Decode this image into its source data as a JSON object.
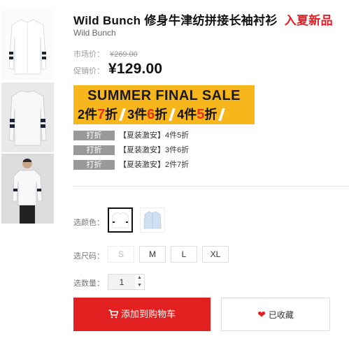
{
  "product": {
    "name": "Wild Bunch 修身牛津纺拼接长袖衬衫",
    "tag": "入夏新品",
    "brand": "Wild Bunch"
  },
  "price": {
    "market_label": "市场价：",
    "market_value": "¥269.00",
    "promo_label": "促销价：",
    "promo_value": "¥129.00"
  },
  "banner": {
    "line1": "SUMMER FINAL SALE",
    "offers": [
      {
        "pre": "2件",
        "num": "7",
        "post": "折"
      },
      {
        "pre": "3件",
        "num": "6",
        "post": "折"
      },
      {
        "pre": "4件",
        "num": "5",
        "post": "折"
      }
    ]
  },
  "discounts": [
    {
      "badge": "打折",
      "text": "【夏装激安】4件5折"
    },
    {
      "badge": "打折",
      "text": "【夏装激安】3件6折"
    },
    {
      "badge": "打折",
      "text": "【夏装激安】2件7折"
    }
  ],
  "options": {
    "color_label": "选颜色：",
    "size_label": "选尺码：",
    "sizes": [
      {
        "label": "S",
        "disabled": true
      },
      {
        "label": "M",
        "disabled": false
      },
      {
        "label": "L",
        "disabled": false
      },
      {
        "label": "XL",
        "disabled": false
      }
    ],
    "qty_label": "选数量：",
    "qty_value": "1"
  },
  "actions": {
    "add_to_cart": "添加到购物车",
    "favorited": "已收藏"
  },
  "colors": {
    "accent_red": "#e32020",
    "banner_yellow": "#f7b61c",
    "badge_gray": "#999999"
  }
}
